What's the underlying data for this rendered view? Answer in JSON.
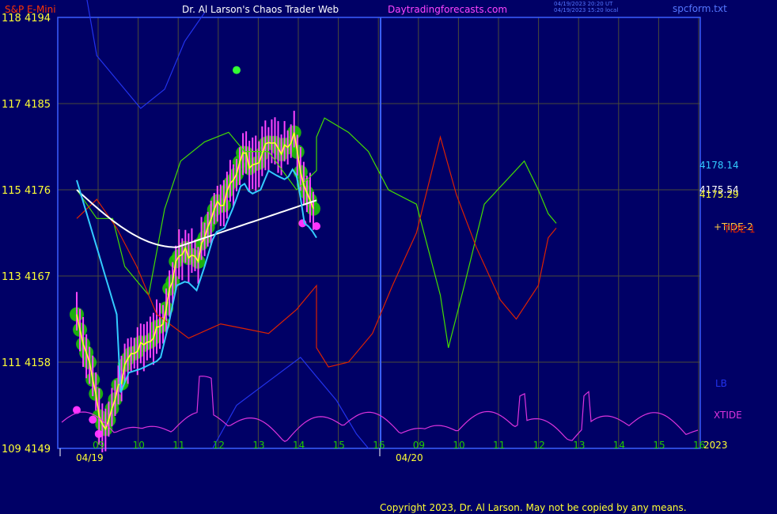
{
  "header": {
    "symbol": "S&P E-Mini",
    "title": "Dr. Al Larson's Chaos Trader Web",
    "site": "Daytradingforecasts.com",
    "ut_time": "04/19/2023 20:20 UT",
    "local_time": "04/19/2023 15:20 local",
    "file": "spcform.txt"
  },
  "footer": {
    "copyright": "Copyright 2023, Dr. Al Larson. May not be copied by any means."
  },
  "colors": {
    "background": "#000066",
    "grid": "#4a4a3a",
    "axis": "#3a5fff",
    "price": "#ffff33",
    "dots": "#22cc00",
    "bars": "#ff44ff",
    "white_ma": "#ffffff",
    "cyan_ma": "#33ccff",
    "tide_red": "#dd2200",
    "tide_green": "#44dd00",
    "lb": "#2233ee",
    "xtide": "#dd33dd"
  },
  "chart_data": {
    "type": "line",
    "y_axis_labels": [
      {
        "cycle": "118",
        "price": "4194"
      },
      {
        "cycle": "117",
        "price": "4185"
      },
      {
        "cycle": "115",
        "price": "4176"
      },
      {
        "cycle": "113",
        "price": "4167"
      },
      {
        "cycle": "111",
        "price": "4158"
      },
      {
        "cycle": "109",
        "price": "4149"
      }
    ],
    "ylim": [
      4149,
      4194
    ],
    "x_hour_labels": [
      "09",
      "10",
      "11",
      "12",
      "13",
      "14",
      "15",
      "16",
      "09",
      "10",
      "11",
      "12",
      "13",
      "14",
      "15",
      "16"
    ],
    "date_labels": [
      "04/19",
      "04/20"
    ],
    "year_label": "2023",
    "right_labels": [
      "4178.14",
      "4175.54",
      "4175.29",
      "+TIDE-2",
      "TIDE-1",
      "LB",
      "XTIDE"
    ],
    "price_path": [
      [
        0,
        4163
      ],
      [
        0.4,
        4156.5
      ],
      [
        0.55,
        4153
      ],
      [
        0.7,
        4151.3
      ],
      [
        0.85,
        4152
      ],
      [
        1,
        4154.8
      ],
      [
        1.3,
        4158.5
      ],
      [
        1.6,
        4159.5
      ],
      [
        1.85,
        4160.5
      ],
      [
        2.1,
        4161.5
      ],
      [
        2.3,
        4165
      ],
      [
        2.5,
        4169
      ],
      [
        2.75,
        4169.5
      ],
      [
        3,
        4168.5
      ],
      [
        3.2,
        4171
      ],
      [
        3.45,
        4174.5
      ],
      [
        3.7,
        4175
      ],
      [
        3.95,
        4177.5
      ],
      [
        4.15,
        4180
      ],
      [
        4.35,
        4178.5
      ],
      [
        4.6,
        4179
      ],
      [
        4.8,
        4181
      ],
      [
        5.0,
        4180.5
      ],
      [
        5.25,
        4180
      ],
      [
        5.45,
        4181.5
      ],
      [
        5.55,
        4179.5
      ],
      [
        5.7,
        4175.5
      ],
      [
        5.85,
        4175
      ],
      [
        6.0,
        4174
      ]
    ],
    "series": [
      {
        "name": "+TIDE-2",
        "values": [
          [
            0,
            4176
          ],
          [
            0.5,
            4173
          ],
          [
            0.9,
            4173
          ],
          [
            1.2,
            4168
          ],
          [
            1.8,
            4165
          ],
          [
            2.2,
            4174
          ],
          [
            2.6,
            4179
          ],
          [
            3.2,
            4181
          ],
          [
            3.8,
            4182
          ],
          [
            4.2,
            4180
          ],
          [
            4.8,
            4180
          ],
          [
            5.5,
            4176
          ],
          [
            6.0,
            4178
          ],
          [
            6.0,
            4181.5
          ],
          [
            6.2,
            4183.5
          ],
          [
            6.8,
            4182
          ],
          [
            7.3,
            4180
          ],
          [
            7.8,
            4176
          ],
          [
            8.5,
            4174.5
          ],
          [
            9.1,
            4165
          ],
          [
            9.3,
            4159.5
          ],
          [
            9.7,
            4166
          ],
          [
            10.2,
            4174.5
          ],
          [
            11.2,
            4179
          ],
          [
            11.55,
            4176
          ],
          [
            11.8,
            4173.5
          ],
          [
            12.0,
            4172.5
          ]
        ]
      },
      {
        "name": "TIDE-1",
        "values": [
          [
            0,
            4173
          ],
          [
            0.5,
            4175
          ],
          [
            1.0,
            4172
          ],
          [
            1.5,
            4168
          ],
          [
            2.0,
            4163
          ],
          [
            2.8,
            4160.5
          ],
          [
            3.6,
            4162
          ],
          [
            4.2,
            4161.5
          ],
          [
            4.8,
            4161
          ],
          [
            5.5,
            4163.5
          ],
          [
            6.0,
            4166
          ],
          [
            6.0,
            4159.5
          ],
          [
            6.3,
            4157.5
          ],
          [
            6.8,
            4158
          ],
          [
            7.4,
            4161
          ],
          [
            7.9,
            4166
          ],
          [
            8.5,
            4171.5
          ],
          [
            9.1,
            4181.5
          ],
          [
            9.5,
            4175.5
          ],
          [
            10.0,
            4170
          ],
          [
            10.6,
            4164.5
          ],
          [
            11.0,
            4162.5
          ],
          [
            11.55,
            4166
          ],
          [
            11.8,
            4171
          ],
          [
            12.0,
            4172
          ]
        ]
      },
      {
        "name": "LB",
        "values": [
          [
            0.25,
            4196
          ],
          [
            0.5,
            4190
          ],
          [
            1.0,
            4187.5
          ],
          [
            1.6,
            4184.5
          ],
          [
            2.2,
            4186.5
          ],
          [
            2.7,
            4191.5
          ],
          [
            3.2,
            4194.5
          ]
        ]
      },
      {
        "name": "LB-2",
        "values": [
          [
            3.4,
            4149
          ],
          [
            4.0,
            4153.5
          ],
          [
            4.8,
            4156
          ],
          [
            5.6,
            4158.5
          ],
          [
            6.0,
            4156.5
          ],
          [
            6.5,
            4154
          ],
          [
            7.0,
            4150.5
          ],
          [
            7.3,
            4149
          ]
        ]
      }
    ]
  }
}
